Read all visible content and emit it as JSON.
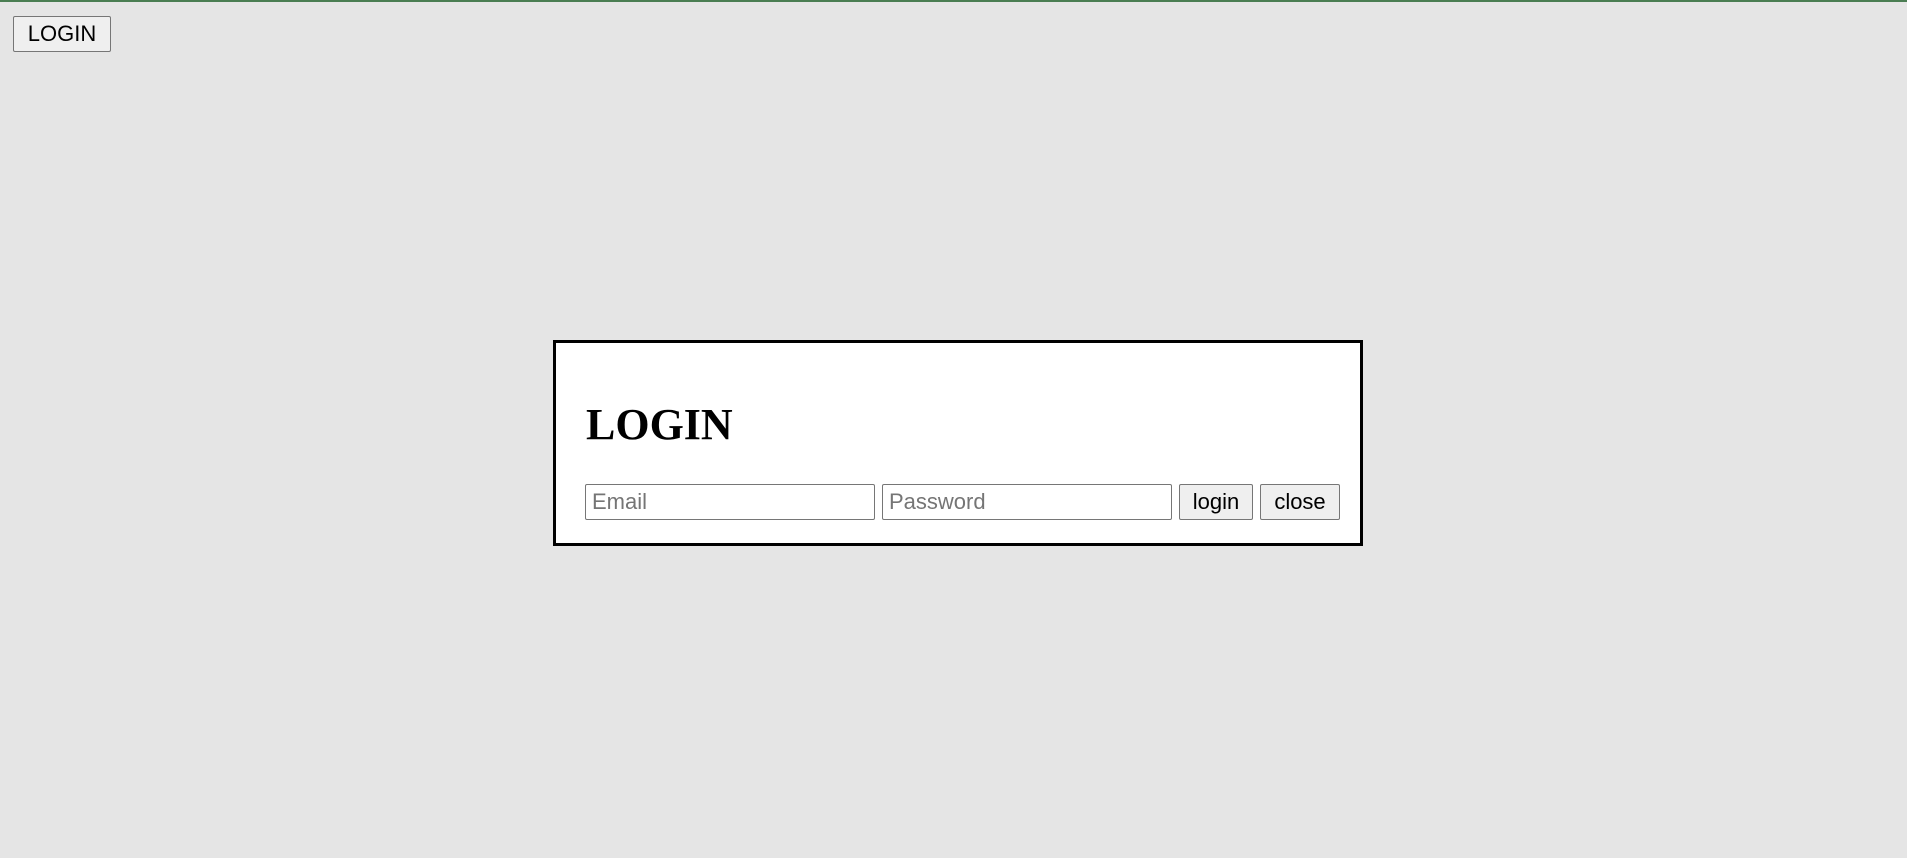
{
  "header": {
    "login_button_label": "LOGIN"
  },
  "modal": {
    "title": "LOGIN",
    "email_placeholder": "Email",
    "email_value": "",
    "password_placeholder": "Password",
    "password_value": "",
    "login_button_label": "login",
    "close_button_label": "close"
  },
  "colors": {
    "background": "#e5e5e5",
    "modal_background": "#ffffff",
    "modal_border": "#000000",
    "top_border": "#4a7d52"
  }
}
